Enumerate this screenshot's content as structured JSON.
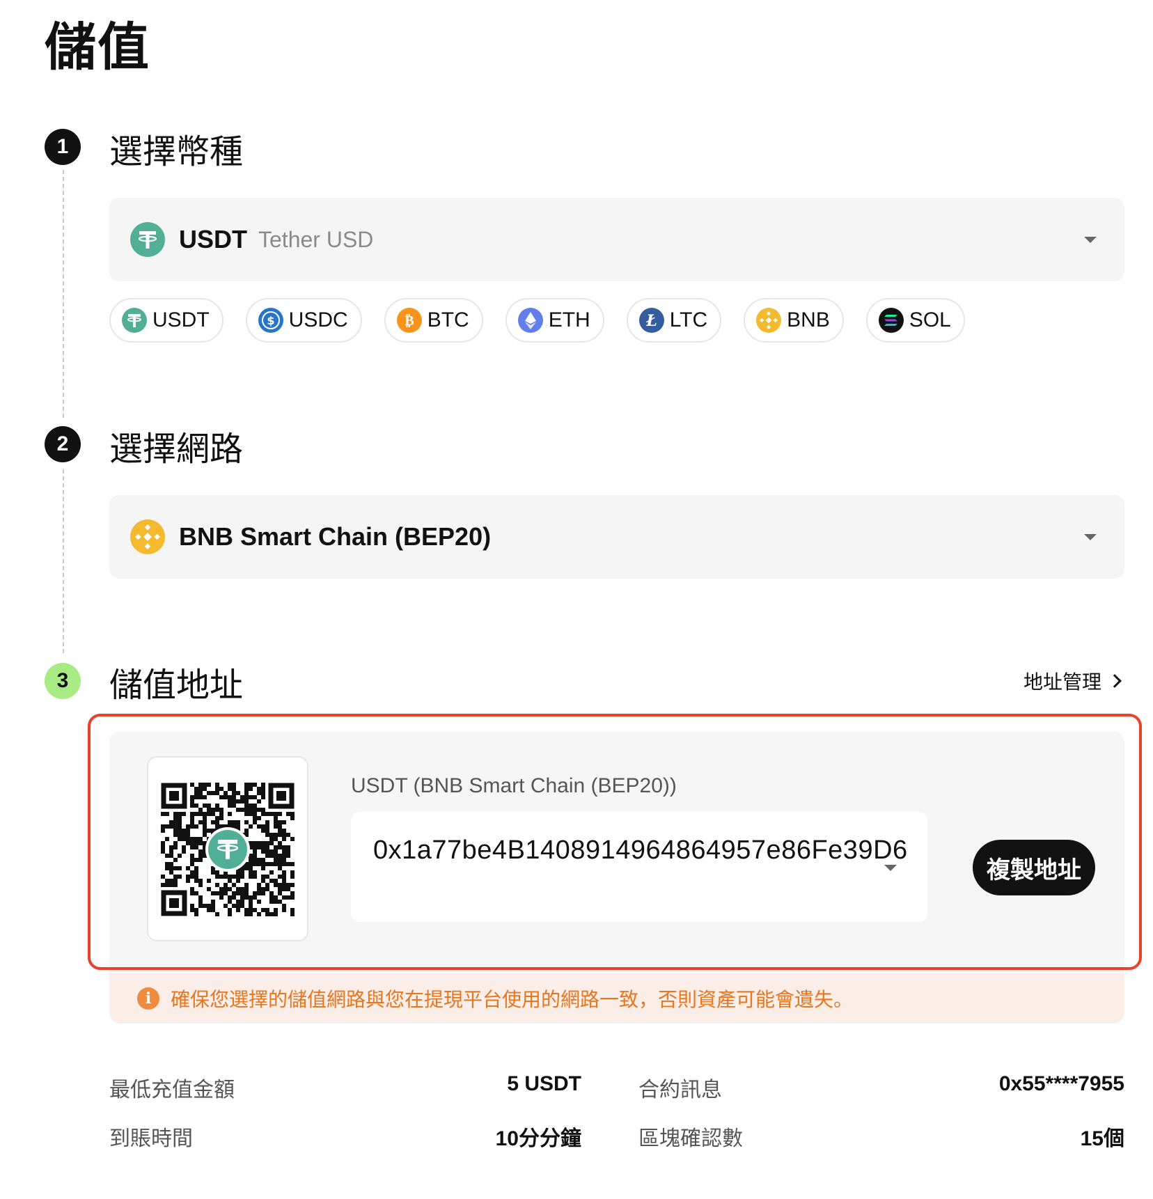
{
  "page": {
    "title": "儲值"
  },
  "steps": [
    {
      "num": "1",
      "title": "選擇幣種"
    },
    {
      "num": "2",
      "title": "選擇網路"
    },
    {
      "num": "3",
      "title": "儲值地址"
    }
  ],
  "coin_select": {
    "symbol": "USDT",
    "name": "Tether USD",
    "icon": "tether-icon"
  },
  "quick_coins": [
    {
      "label": "USDT",
      "icon": "tether-icon",
      "color": "#50AF95"
    },
    {
      "label": "USDC",
      "icon": "usdc-icon",
      "color": "#2775CA"
    },
    {
      "label": "BTC",
      "icon": "bitcoin-icon",
      "color": "#F7931A"
    },
    {
      "label": "ETH",
      "icon": "ethereum-icon",
      "color": "#627EEA"
    },
    {
      "label": "LTC",
      "icon": "litecoin-icon",
      "color": "#345D9D"
    },
    {
      "label": "BNB",
      "icon": "bnb-icon",
      "color": "#F3BA2F"
    },
    {
      "label": "SOL",
      "icon": "solana-icon",
      "color": "#111111"
    }
  ],
  "network_select": {
    "label": "BNB Smart Chain (BEP20)",
    "icon": "bnb-icon"
  },
  "address_manage": "地址管理",
  "deposit": {
    "label": "USDT (BNB Smart Chain (BEP20))",
    "address": "0x1a77be4B1408914964864957e86Fe39D6",
    "copy_label": "複製地址"
  },
  "warning": "確保您選擇的儲值網路與您在提現平台使用的網路一致，否則資產可能會遺失。",
  "info": [
    {
      "label": "最低充值金額",
      "value": "5 USDT"
    },
    {
      "label": "合約訊息",
      "value": "0x55****7955"
    },
    {
      "label": "到賬時間",
      "value": "10分分鐘"
    },
    {
      "label": "區塊確認數",
      "value": "15個"
    }
  ],
  "colors": {
    "accent_step": "#A8EB85",
    "warning": "#E8761E",
    "highlight_border": "#E8412C"
  }
}
